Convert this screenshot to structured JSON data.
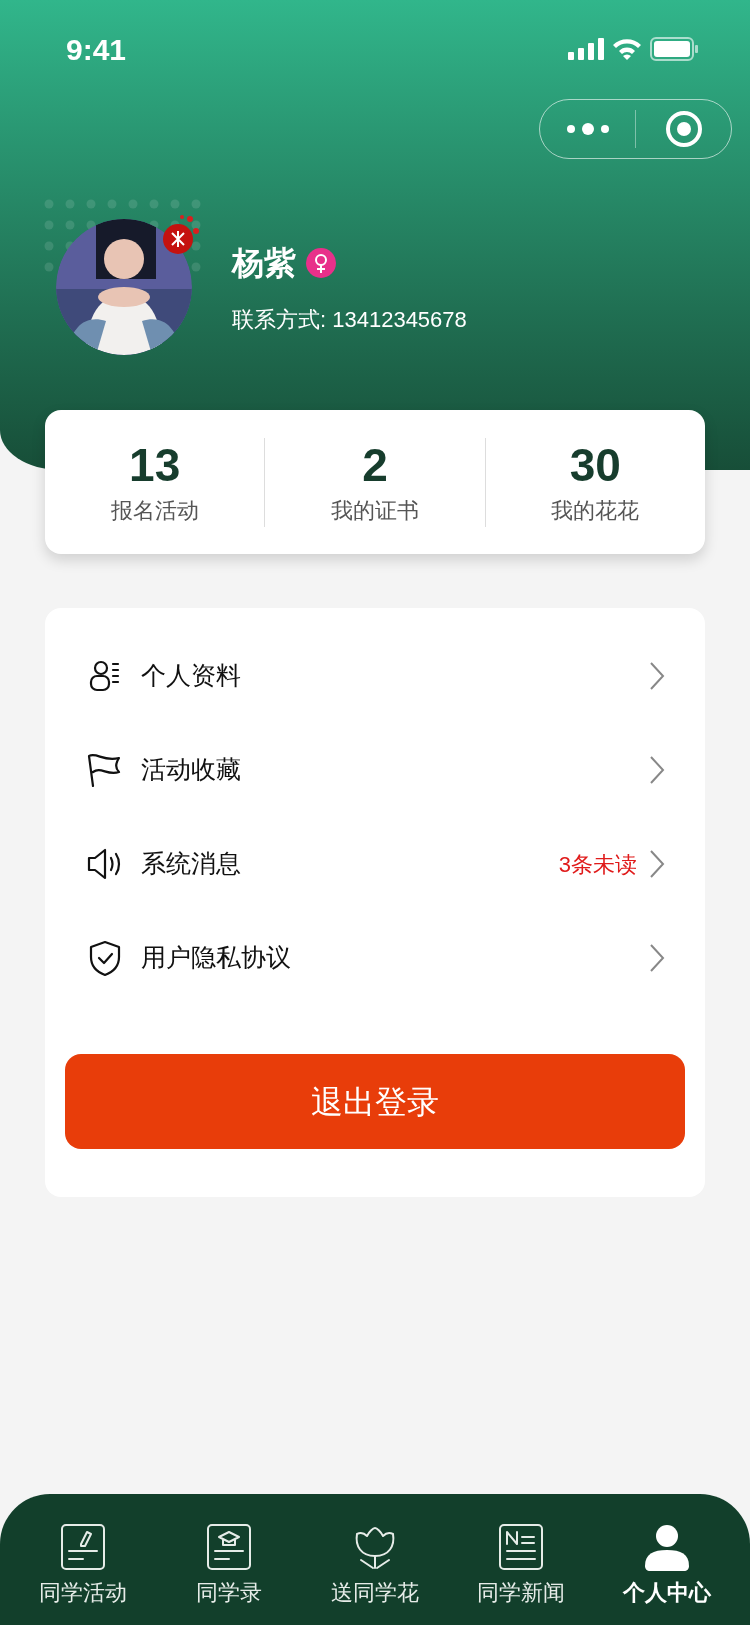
{
  "status_bar": {
    "time": "9:41"
  },
  "profile": {
    "name": "杨紫",
    "contact": "联系方式: 13412345678"
  },
  "stats": [
    {
      "value": "13",
      "label": "报名活动"
    },
    {
      "value": "2",
      "label": "我的证书"
    },
    {
      "value": "30",
      "label": "我的花花"
    }
  ],
  "menu": [
    {
      "label": "个人资料"
    },
    {
      "label": "活动收藏"
    },
    {
      "label": "系统消息",
      "badge": "3条未读"
    },
    {
      "label": "用户隐私协议"
    }
  ],
  "logout_button": "退出登录",
  "tabs": [
    {
      "label": "同学活动",
      "selected": false
    },
    {
      "label": "同学录",
      "selected": false
    },
    {
      "label": "送同学花",
      "selected": false
    },
    {
      "label": "同学新闻",
      "selected": false
    },
    {
      "label": "个人中心",
      "selected": true
    }
  ]
}
